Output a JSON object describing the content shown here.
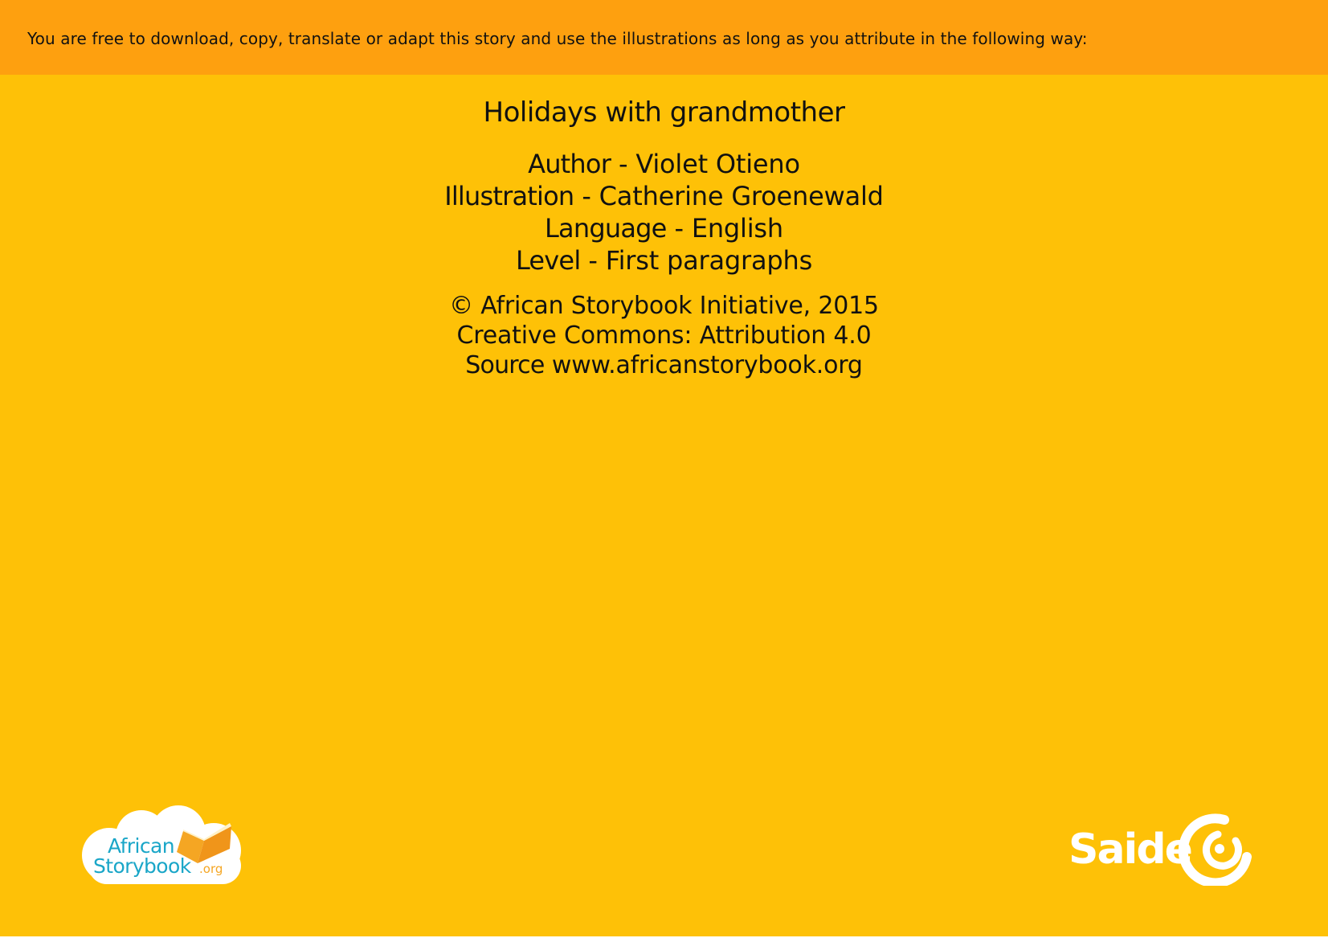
{
  "banner": {
    "text": "You are free to download, copy, translate or adapt this story and use the illustrations as long as you attribute in the following way:"
  },
  "book": {
    "title": "Holidays with grandmother",
    "credits": [
      {
        "label": "Author",
        "value": " - Violet Otieno"
      },
      {
        "label": "Illustration",
        "value": " - Catherine Groenewald"
      },
      {
        "label": "Language",
        "value": " - English"
      },
      {
        "label": "Level",
        "value": " - First paragraphs"
      }
    ]
  },
  "license": {
    "copyright": "© African Storybook Initiative, 2015",
    "cc": "Creative Commons: Attribution 4.0",
    "source_label": "Source",
    "source_value": " www.africanstorybook.org"
  },
  "logos": {
    "asb": {
      "line1": "African",
      "line2": "Storybook",
      "suffix": ".org"
    },
    "saide": {
      "text": "Saide"
    }
  },
  "colors": {
    "page_background": "#FEC107",
    "banner_background": "#FEA00F",
    "text": "#111111",
    "asb_blue": "#1AA6C8",
    "asb_orange": "#F5A623",
    "saide_white": "#FFFFFF"
  }
}
